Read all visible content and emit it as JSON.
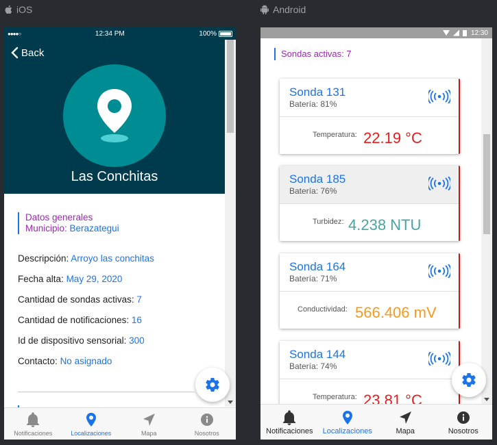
{
  "platforms": {
    "ios": "iOS",
    "android": "Android"
  },
  "ios": {
    "status": {
      "signal": "●●●●○ ",
      "time": "12:34 PM",
      "battery": "100%"
    },
    "back_label": "Back",
    "title": "Las Conchitas",
    "general": {
      "heading": "Datos generales",
      "municipio_label": "Municipio:",
      "municipio_value": "Berazategui"
    },
    "fields": [
      {
        "label": "Descripción:",
        "value": "Arroyo las conchitas"
      },
      {
        "label": "Fecha alta:",
        "value": "May 29, 2020"
      },
      {
        "label": "Cantidad de sondas activas:",
        "value": "7"
      },
      {
        "label": "Cantidad de notificaciones:",
        "value": "16"
      },
      {
        "label": "Id de dispositivo sensorial:",
        "value": "300"
      },
      {
        "label": "Contacto:",
        "value": "No asignado"
      }
    ],
    "tabs": [
      "Notificaciones",
      "Localizaciones",
      "Mapa",
      "Nosotros"
    ]
  },
  "android": {
    "status": {
      "time": "12:30"
    },
    "sondas_activas": "Sondas activas: 7",
    "cards": [
      {
        "title": "Sonda 131",
        "battery": "Batería: 81%",
        "label": "Temperatura:",
        "value": "22.19 °C",
        "value_color": "#e81c1c"
      },
      {
        "title": "Sonda 185",
        "battery": "Batería: 76%",
        "label": "Turbidez:",
        "value": "4.238 NTU",
        "value_color": "#4aa3a3"
      },
      {
        "title": "Sonda 164",
        "battery": "Batería: 71%",
        "label": "Conductividad:",
        "value": "566.406 mV",
        "value_color": "#f39a1f"
      },
      {
        "title": "Sonda 144",
        "battery": "Batería: 74%",
        "label": "Temperatura:",
        "value": "23.81 °C",
        "value_color": "#e81c1c"
      }
    ],
    "tabs": [
      "Notificaciones",
      "Localizaciones",
      "Mapa",
      "Nosotros"
    ]
  },
  "colors": {
    "header": "#003a4d",
    "avatar": "#008c93",
    "accent": "#1a73e8",
    "purple": "#9c27b0",
    "card_border": "#b71c1c"
  }
}
